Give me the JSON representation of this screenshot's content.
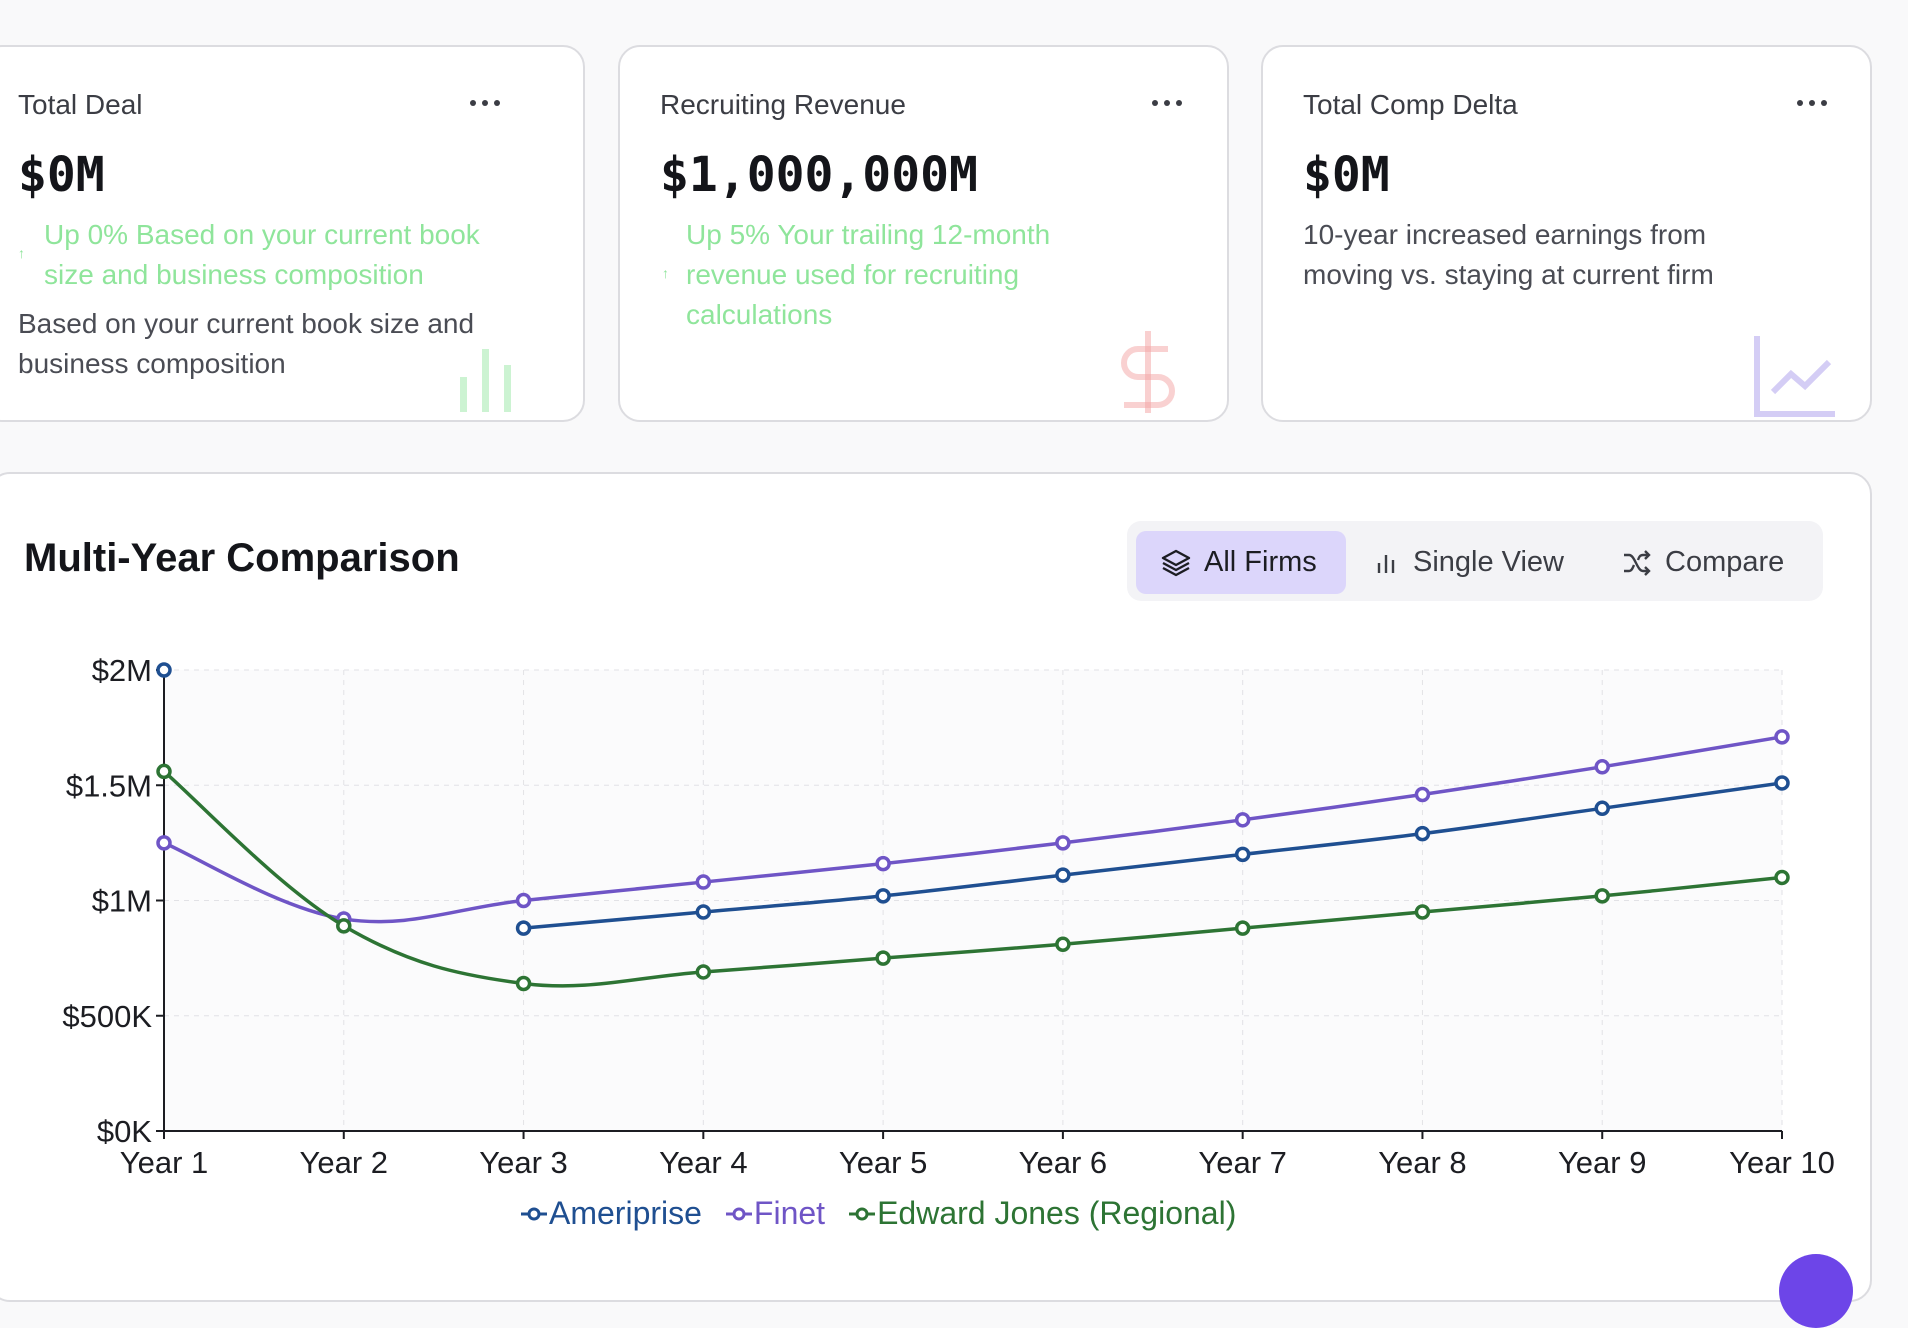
{
  "cards": [
    {
      "title": "Total Deal",
      "value": "$0M",
      "trend_line1": "Up 0% Based on your current book",
      "trend_line2": "size and business composition",
      "desc_line1": "Based on your current book size and",
      "desc_line2": "business composition",
      "icon": "bar-chart-icon",
      "icon_color": "#8fe59b"
    },
    {
      "title": "Recruiting Revenue",
      "value": "$1,000,000M",
      "trend_line1": "Up 5% Your trailing 12-month",
      "trend_line2": "revenue used for recruiting",
      "trend_line3": "calculations",
      "icon": "dollar-icon",
      "icon_color": "#f4a3a3"
    },
    {
      "title": "Total Comp Delta",
      "value": "$0M",
      "desc_line1": "10-year increased earnings from",
      "desc_line2": "moving vs. staying at current firm",
      "icon": "line-chart-icon",
      "icon_color": "#c9c0f3"
    }
  ],
  "section": {
    "title": "Multi-Year Comparison",
    "views": [
      {
        "label": "All Firms",
        "icon": "layers-icon",
        "active": true
      },
      {
        "label": "Single View",
        "icon": "bar-chart-icon",
        "active": false
      },
      {
        "label": "Compare",
        "icon": "shuffle-icon",
        "active": false
      }
    ]
  },
  "colors": {
    "accent": "#6d45e8",
    "ameriprise": "#1f4f91",
    "finet": "#6f55c6",
    "edward_jones": "#2d7434",
    "trend_green": "#8fe59b"
  },
  "chart_data": {
    "type": "line",
    "x": [
      "Year 1",
      "Year 2",
      "Year 3",
      "Year 4",
      "Year 5",
      "Year 6",
      "Year 7",
      "Year 8",
      "Year 9",
      "Year 10"
    ],
    "ylim": [
      0,
      2000000
    ],
    "yticks": [
      {
        "value": 0,
        "label": "$0K"
      },
      {
        "value": 500000,
        "label": "$500K"
      },
      {
        "value": 1000000,
        "label": "$1M"
      },
      {
        "value": 1500000,
        "label": "$1.5M"
      },
      {
        "value": 2000000,
        "label": "$2M"
      }
    ],
    "grid": true,
    "legend": "bottom",
    "series": [
      {
        "name": "Ameriprise",
        "color": "#1f4f91",
        "values": [
          2000000,
          null,
          880000,
          950000,
          1020000,
          1110000,
          1200000,
          1290000,
          1400000,
          1510000
        ]
      },
      {
        "name": "Finet",
        "color": "#6f55c6",
        "values": [
          1250000,
          920000,
          1000000,
          1080000,
          1160000,
          1250000,
          1350000,
          1460000,
          1580000,
          1710000
        ]
      },
      {
        "name": "Edward Jones (Regional)",
        "color": "#2d7434",
        "values": [
          1560000,
          890000,
          640000,
          690000,
          750000,
          810000,
          880000,
          950000,
          1020000,
          1100000
        ]
      }
    ]
  }
}
